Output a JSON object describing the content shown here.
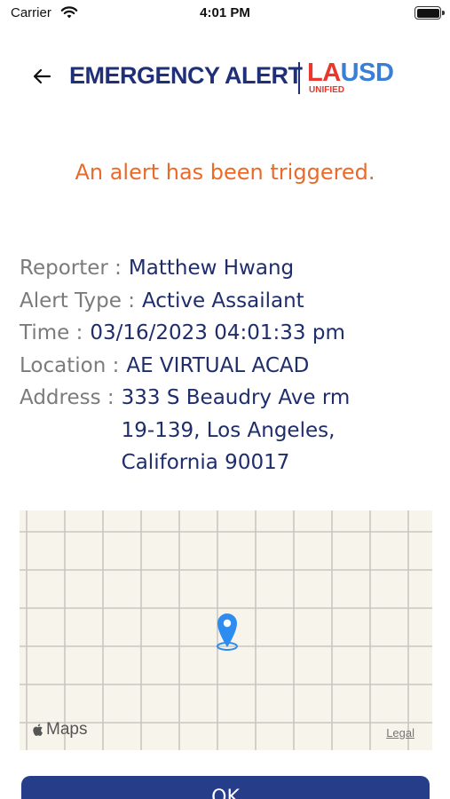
{
  "status_bar": {
    "carrier": "Carrier",
    "time": "4:01 PM"
  },
  "header": {
    "title": "EMERGENCY ALERT",
    "logo": {
      "part1": "LA",
      "part2": "USD",
      "sub": "UNIFIED"
    }
  },
  "alert_message": "An alert has been triggered.",
  "details": {
    "reporter_label": "Reporter :",
    "reporter_value": "Matthew Hwang",
    "alert_type_label": "Alert Type :",
    "alert_type_value": "Active Assailant",
    "time_label": "Time :",
    "time_value": "03/16/2023 04:01:33 pm",
    "location_label": "Location :",
    "location_value": "AE VIRTUAL ACAD",
    "address_label": "Address :",
    "address_lines": [
      "333 S Beaudry Ave rm",
      "19-139, Los Angeles,",
      "California 90017"
    ]
  },
  "map": {
    "brand": "Maps",
    "legal": "Legal"
  },
  "ok_button": "OK",
  "colors": {
    "brand_navy": "#1f2f78",
    "alert_orange": "#ea6a2a",
    "pin_blue": "#2d8cf0",
    "button_blue": "#263d8a",
    "logo_red": "#e8382e",
    "logo_blue": "#3a7fd6"
  },
  "icons": [
    "wifi-icon",
    "battery-icon",
    "back-arrow-icon",
    "map-pin-icon",
    "apple-icon"
  ]
}
